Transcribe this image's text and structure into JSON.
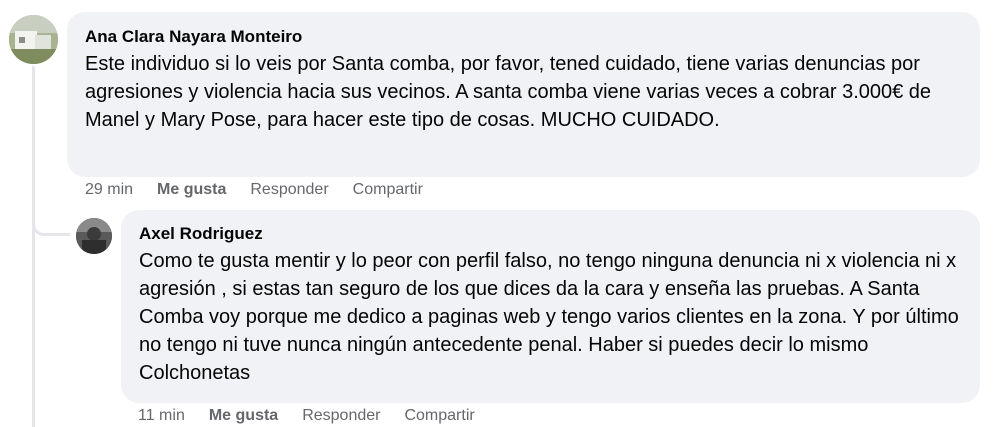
{
  "comments": [
    {
      "author": "Ana Clara Nayara Monteiro",
      "text": "Este individuo si lo veis por Santa comba, por favor, tened cuidado, tiene varias denuncias por agresiones y violencia hacia sus vecinos. A santa comba viene varias veces a cobrar 3.000€ de Manel y Mary Pose, para hacer este tipo de cosas. MUCHO CUIDADO.",
      "time": "29 min",
      "like_label": "Me gusta",
      "reply_label": "Responder",
      "share_label": "Compartir"
    },
    {
      "author": "Axel Rodriguez",
      "text": "Como te gusta mentir y lo peor con perfil falso, no tengo ninguna denuncia ni x violencia ni x agresión , si estas tan seguro de los que dices da la cara y enseña las pruebas. A Santa Comba voy porque me dedico a paginas web y tengo varios clientes en la zona. Y por último no tengo ni tuve nunca ningún antecedente penal. Haber si puedes decir lo mismo Colchonetas",
      "time": "11 min",
      "like_label": "Me gusta",
      "reply_label": "Responder",
      "share_label": "Compartir"
    }
  ],
  "colors": {
    "bubble_bg": "#f0f2f5",
    "meta_text": "#65676b",
    "thread_line": "#e4e6eb"
  }
}
